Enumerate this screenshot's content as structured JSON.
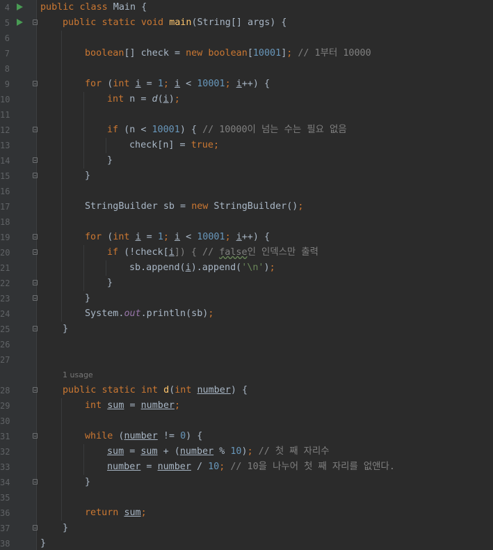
{
  "editor": {
    "line_numbers": [
      "4",
      "5",
      "6",
      "7",
      "8",
      "9",
      "10",
      "11",
      "12",
      "13",
      "14",
      "15",
      "16",
      "17",
      "18",
      "19",
      "20",
      "21",
      "22",
      "23",
      "24",
      "25",
      "26",
      "27",
      "",
      "28",
      "29",
      "30",
      "31",
      "32",
      "33",
      "34",
      "35",
      "36",
      "37",
      "38"
    ],
    "usage_hint": "1 usage",
    "code": {
      "l4": [
        "public",
        " ",
        "class",
        " Main {"
      ],
      "l5": [
        "public",
        " ",
        "static",
        " ",
        "void",
        " ",
        "main",
        "(String[] args) {"
      ],
      "l7": [
        "boolean",
        "[] check = ",
        "new",
        " ",
        "boolean",
        "[",
        "10001",
        "]",
        ";",
        " // 1부터 10000"
      ],
      "l9": [
        "for",
        " (",
        "int",
        " ",
        "i",
        " = ",
        "1",
        ";",
        " ",
        "i",
        " < ",
        "10001",
        ";",
        " ",
        "i",
        "++) {"
      ],
      "l10": [
        "int",
        " n = ",
        "d",
        "(",
        "i",
        ")",
        ";"
      ],
      "l12": [
        "if",
        " (n < ",
        "10001",
        ") { ",
        "// 10000이 넘는 수는 필요 없음"
      ],
      "l13": [
        "check[n] = ",
        "true",
        ";"
      ],
      "l14": [
        "}"
      ],
      "l15": [
        "}"
      ],
      "l17": [
        "StringBuilder sb = ",
        "new",
        " StringBuilder()",
        ";"
      ],
      "l19": [
        "for",
        " (",
        "int",
        " ",
        "i",
        " = ",
        "1",
        ";",
        " ",
        "i",
        " < ",
        "10001",
        ";",
        " ",
        "i",
        "++) {"
      ],
      "l20": [
        "if",
        " (!check[",
        "i",
        "]) { // ",
        "false",
        "인 인덱스만 출력"
      ],
      "l21": [
        "sb.append(",
        "i",
        ").append(",
        "'\\n'",
        ")",
        ";"
      ],
      "l22": [
        "}"
      ],
      "l23": [
        "}"
      ],
      "l24": [
        "System.",
        "out",
        ".println(sb)",
        ";"
      ],
      "l25": [
        "}"
      ],
      "l28": [
        "public",
        " ",
        "static",
        " ",
        "int",
        " ",
        "d",
        "(",
        "int",
        " ",
        "number",
        ") {"
      ],
      "l29": [
        "int",
        " ",
        "sum",
        " = ",
        "number",
        ";"
      ],
      "l31": [
        "while",
        " (",
        "number",
        " != ",
        "0",
        ") {"
      ],
      "l32": [
        "sum",
        " = ",
        "sum",
        " + (",
        "number",
        " % ",
        "10",
        ")",
        ";",
        " // 첫 째 자리수"
      ],
      "l33": [
        "number",
        " = ",
        "number",
        " / ",
        "10",
        ";",
        " // 10을 나누어 첫 째 자리를 없앤다."
      ],
      "l34": [
        "}"
      ],
      "l36": [
        "return",
        " ",
        "sum",
        ";"
      ],
      "l37": [
        "}"
      ],
      "l38": [
        "}"
      ]
    }
  },
  "colors": {
    "background": "#2b2b2b",
    "gutter": "#313335",
    "keyword": "#cc7832",
    "number": "#6897bb",
    "comment": "#808080",
    "function": "#ffc66d",
    "string": "#6a8759",
    "field": "#9876aa",
    "default": "#a9b7c6",
    "run_icon": "#499c54"
  },
  "icons": [
    "run-icon",
    "fold-icon"
  ]
}
